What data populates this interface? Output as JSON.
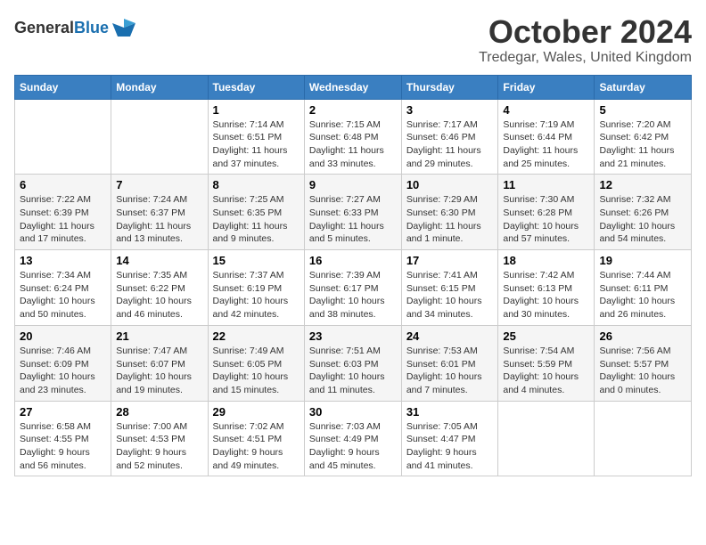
{
  "header": {
    "logo_general": "General",
    "logo_blue": "Blue",
    "month_title": "October 2024",
    "location": "Tredegar, Wales, United Kingdom"
  },
  "days_of_week": [
    "Sunday",
    "Monday",
    "Tuesday",
    "Wednesday",
    "Thursday",
    "Friday",
    "Saturday"
  ],
  "weeks": [
    [
      {
        "day": "",
        "info": ""
      },
      {
        "day": "",
        "info": ""
      },
      {
        "day": "1",
        "info": "Sunrise: 7:14 AM\nSunset: 6:51 PM\nDaylight: 11 hours and 37 minutes."
      },
      {
        "day": "2",
        "info": "Sunrise: 7:15 AM\nSunset: 6:48 PM\nDaylight: 11 hours and 33 minutes."
      },
      {
        "day": "3",
        "info": "Sunrise: 7:17 AM\nSunset: 6:46 PM\nDaylight: 11 hours and 29 minutes."
      },
      {
        "day": "4",
        "info": "Sunrise: 7:19 AM\nSunset: 6:44 PM\nDaylight: 11 hours and 25 minutes."
      },
      {
        "day": "5",
        "info": "Sunrise: 7:20 AM\nSunset: 6:42 PM\nDaylight: 11 hours and 21 minutes."
      }
    ],
    [
      {
        "day": "6",
        "info": "Sunrise: 7:22 AM\nSunset: 6:39 PM\nDaylight: 11 hours and 17 minutes."
      },
      {
        "day": "7",
        "info": "Sunrise: 7:24 AM\nSunset: 6:37 PM\nDaylight: 11 hours and 13 minutes."
      },
      {
        "day": "8",
        "info": "Sunrise: 7:25 AM\nSunset: 6:35 PM\nDaylight: 11 hours and 9 minutes."
      },
      {
        "day": "9",
        "info": "Sunrise: 7:27 AM\nSunset: 6:33 PM\nDaylight: 11 hours and 5 minutes."
      },
      {
        "day": "10",
        "info": "Sunrise: 7:29 AM\nSunset: 6:30 PM\nDaylight: 11 hours and 1 minute."
      },
      {
        "day": "11",
        "info": "Sunrise: 7:30 AM\nSunset: 6:28 PM\nDaylight: 10 hours and 57 minutes."
      },
      {
        "day": "12",
        "info": "Sunrise: 7:32 AM\nSunset: 6:26 PM\nDaylight: 10 hours and 54 minutes."
      }
    ],
    [
      {
        "day": "13",
        "info": "Sunrise: 7:34 AM\nSunset: 6:24 PM\nDaylight: 10 hours and 50 minutes."
      },
      {
        "day": "14",
        "info": "Sunrise: 7:35 AM\nSunset: 6:22 PM\nDaylight: 10 hours and 46 minutes."
      },
      {
        "day": "15",
        "info": "Sunrise: 7:37 AM\nSunset: 6:19 PM\nDaylight: 10 hours and 42 minutes."
      },
      {
        "day": "16",
        "info": "Sunrise: 7:39 AM\nSunset: 6:17 PM\nDaylight: 10 hours and 38 minutes."
      },
      {
        "day": "17",
        "info": "Sunrise: 7:41 AM\nSunset: 6:15 PM\nDaylight: 10 hours and 34 minutes."
      },
      {
        "day": "18",
        "info": "Sunrise: 7:42 AM\nSunset: 6:13 PM\nDaylight: 10 hours and 30 minutes."
      },
      {
        "day": "19",
        "info": "Sunrise: 7:44 AM\nSunset: 6:11 PM\nDaylight: 10 hours and 26 minutes."
      }
    ],
    [
      {
        "day": "20",
        "info": "Sunrise: 7:46 AM\nSunset: 6:09 PM\nDaylight: 10 hours and 23 minutes."
      },
      {
        "day": "21",
        "info": "Sunrise: 7:47 AM\nSunset: 6:07 PM\nDaylight: 10 hours and 19 minutes."
      },
      {
        "day": "22",
        "info": "Sunrise: 7:49 AM\nSunset: 6:05 PM\nDaylight: 10 hours and 15 minutes."
      },
      {
        "day": "23",
        "info": "Sunrise: 7:51 AM\nSunset: 6:03 PM\nDaylight: 10 hours and 11 minutes."
      },
      {
        "day": "24",
        "info": "Sunrise: 7:53 AM\nSunset: 6:01 PM\nDaylight: 10 hours and 7 minutes."
      },
      {
        "day": "25",
        "info": "Sunrise: 7:54 AM\nSunset: 5:59 PM\nDaylight: 10 hours and 4 minutes."
      },
      {
        "day": "26",
        "info": "Sunrise: 7:56 AM\nSunset: 5:57 PM\nDaylight: 10 hours and 0 minutes."
      }
    ],
    [
      {
        "day": "27",
        "info": "Sunrise: 6:58 AM\nSunset: 4:55 PM\nDaylight: 9 hours and 56 minutes."
      },
      {
        "day": "28",
        "info": "Sunrise: 7:00 AM\nSunset: 4:53 PM\nDaylight: 9 hours and 52 minutes."
      },
      {
        "day": "29",
        "info": "Sunrise: 7:02 AM\nSunset: 4:51 PM\nDaylight: 9 hours and 49 minutes."
      },
      {
        "day": "30",
        "info": "Sunrise: 7:03 AM\nSunset: 4:49 PM\nDaylight: 9 hours and 45 minutes."
      },
      {
        "day": "31",
        "info": "Sunrise: 7:05 AM\nSunset: 4:47 PM\nDaylight: 9 hours and 41 minutes."
      },
      {
        "day": "",
        "info": ""
      },
      {
        "day": "",
        "info": ""
      }
    ]
  ]
}
